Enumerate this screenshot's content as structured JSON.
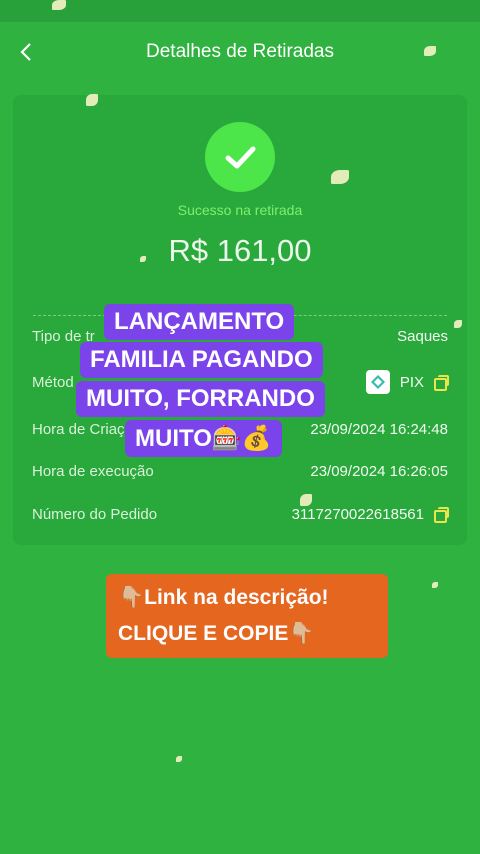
{
  "header": {
    "title": "Detalhes de Retiradas"
  },
  "status": {
    "text": "Sucesso na retirada"
  },
  "amount": "R$ 161,00",
  "details": [
    {
      "label": "Tipo de tr",
      "value": "Saques"
    },
    {
      "label": "Métod",
      "value": "PIX"
    },
    {
      "label": "Hora de Criaç",
      "value": "23/09/2024 16:24:48"
    },
    {
      "label": "Hora de execução",
      "value": "23/09/2024 16:26:05"
    },
    {
      "label": "Número do Pedido",
      "value": "3117270022618561"
    }
  ],
  "overlay": {
    "line1": "LANÇAMENTO",
    "line2": "FAMILIA PAGANDO",
    "line3": "MUITO, FORRANDO",
    "line4": "MUITO🎰💰"
  },
  "cta": {
    "line1": "👇🏼Link na descrição!",
    "line2": "CLIQUE E COPIE👇🏼"
  },
  "colors": {
    "background": "#2fb240",
    "accent_green": "#4ce64a",
    "overlay_purple": "#7b44ea",
    "cta_orange": "#e4661f"
  }
}
